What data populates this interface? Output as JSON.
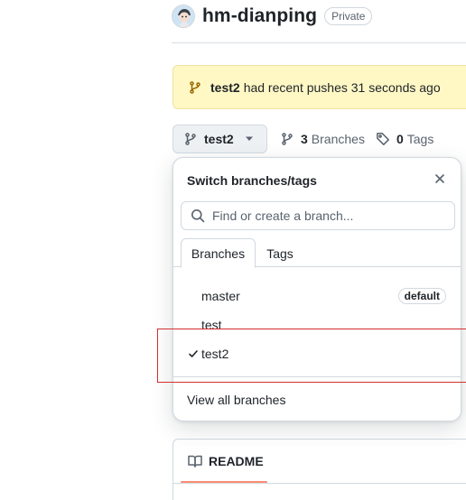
{
  "repo": {
    "name": "hm-dianping",
    "visibility": "Private"
  },
  "flash": {
    "branch": "test2",
    "message": "had recent pushes 31 seconds ago"
  },
  "toolbar": {
    "current_branch": "test2",
    "branches_count": "3",
    "branches_label": "Branches",
    "tags_count": "0",
    "tags_label": "Tags"
  },
  "branch_picker": {
    "title": "Switch branches/tags",
    "search_placeholder": "Find or create a branch...",
    "tabs": [
      {
        "label": "Branches",
        "selected": true
      },
      {
        "label": "Tags",
        "selected": false
      }
    ],
    "items": [
      {
        "name": "master",
        "badge": "default",
        "checked": false
      },
      {
        "name": "test",
        "badge": "",
        "checked": false
      },
      {
        "name": "test2",
        "badge": "",
        "checked": true
      }
    ],
    "footer_link": "View all branches"
  },
  "readme": {
    "tab_label": "README"
  },
  "colors": {
    "flash_bg": "#fff8c5",
    "readme_underline": "#fd8c73",
    "annotation_box": "#d32f2f"
  }
}
